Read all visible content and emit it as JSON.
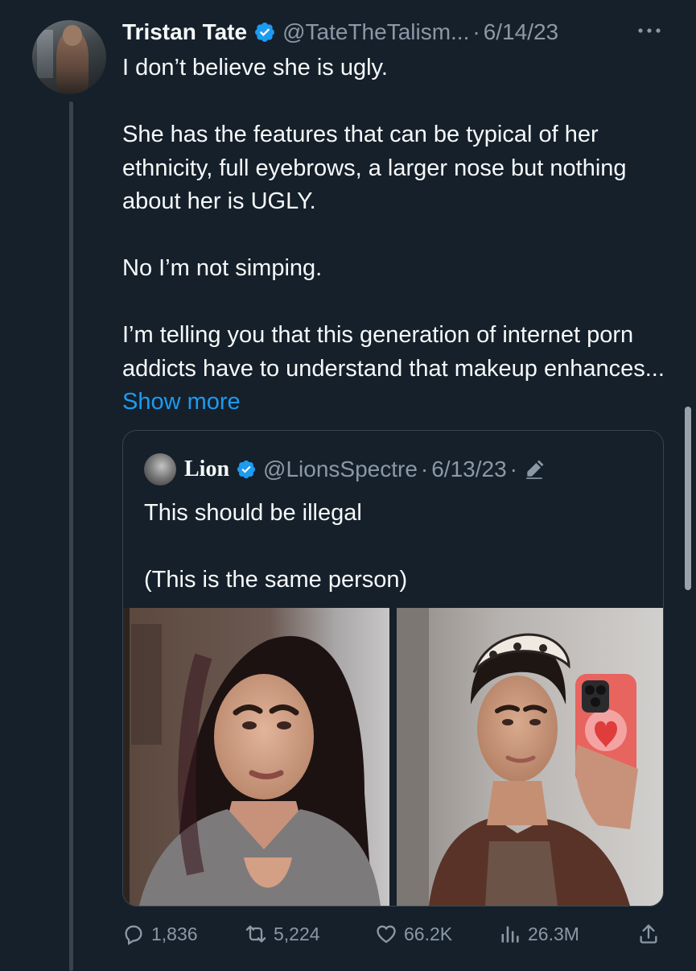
{
  "tweet": {
    "author_name": "Tristan Tate",
    "author_handle": "@TateTheTalism...",
    "separator": "·",
    "date": "6/14/23",
    "paragraphs": [
      "I don’t believe she is ugly.",
      "She has the features that can be typical of her ethnicity, full eyebrows, a larger nose but nothing about her is UGLY.",
      "No I’m not simping.",
      "I’m telling you that this generation of internet porn addicts have to understand that makeup enhances..."
    ],
    "show_more": "Show more",
    "more_icon": "more-horizontal-icon",
    "verified_icon": "verified-badge-icon"
  },
  "quote": {
    "author_name": "Lion",
    "author_handle": "@LionsSpectre",
    "separator": "·",
    "date": "6/13/23",
    "separator2": "·",
    "edit_icon": "edited-pencil-icon",
    "paragraphs": [
      "This should be illegal",
      "(This is the same person)"
    ],
    "media": [
      {
        "alt_icon": "photo-with-makeup"
      },
      {
        "alt_icon": "photo-without-makeup"
      }
    ]
  },
  "actions": {
    "replies": "1,836",
    "retweets": "5,224",
    "likes": "66.2K",
    "views": "26.3M",
    "reply_icon": "reply-icon",
    "retweet_icon": "retweet-icon",
    "like_icon": "heart-icon",
    "views_icon": "views-bar-chart-icon",
    "share_icon": "share-icon"
  },
  "colors": {
    "background": "#15202b",
    "text_primary": "#f7f9f9",
    "text_secondary": "#8b98a5",
    "accent": "#1d9bf0",
    "border": "#38444d"
  }
}
